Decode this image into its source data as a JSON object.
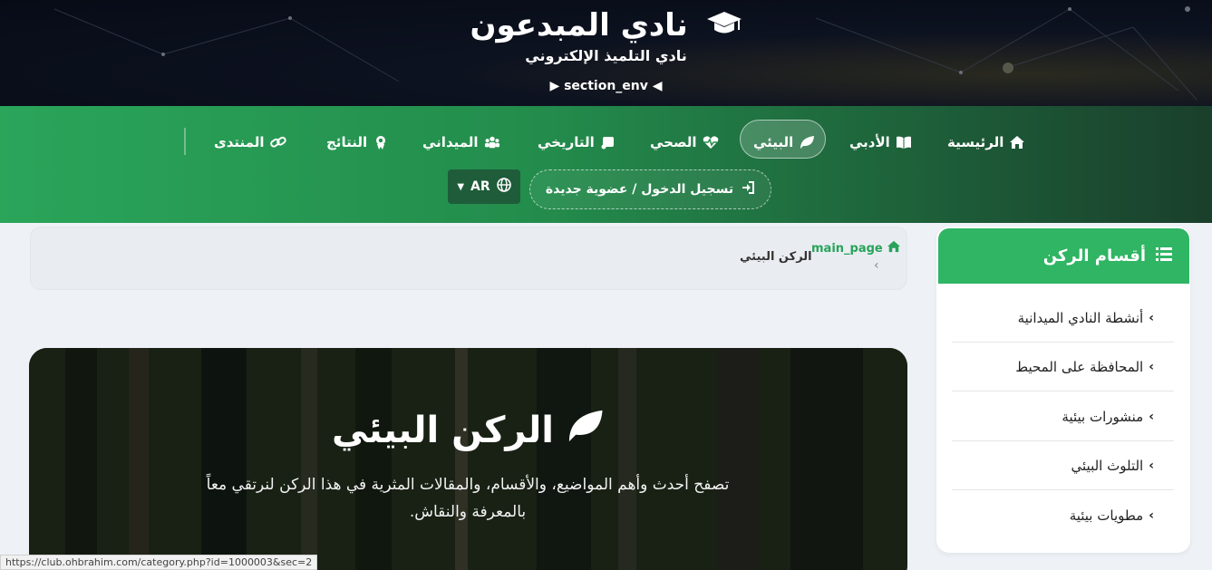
{
  "header": {
    "title": "نادي المبدعون",
    "subtitle": "نادي التلميذ الإلكتروني",
    "section": "▶ section_env ◀"
  },
  "nav": {
    "home": "الرئيسية",
    "literary": "الأدبي",
    "environment": "البيئي",
    "health": "الصحي",
    "history": "التاريخي",
    "field": "الميداني",
    "results": "النتائج",
    "forum": "المنتدى",
    "login": "تسجيل الدخول / عضوية جديدة",
    "lang": "AR"
  },
  "breadcrumb": {
    "home": "main_page",
    "current": "الركن البيئي",
    "sep": "‹"
  },
  "hero": {
    "title": "الركن البيئي",
    "description": "تصفح أحدث وأهم المواضيع، والأقسام، والمقالات المثرية في هذا الركن لنرتقي معاً بالمعرفة والنقاش."
  },
  "sidebar": {
    "title": "أقسام الركن",
    "items": [
      {
        "label": "أنشطة النادي الميدانية"
      },
      {
        "label": "المحافظة على المحيط"
      },
      {
        "label": "منشورات بيئية"
      },
      {
        "label": "التلوث البيئي"
      },
      {
        "label": "مطويات بيئية"
      }
    ]
  },
  "status_url": "https://club.ohbrahim.com/category.php?id=1000003&sec=2",
  "colors": {
    "accent": "#2fb563",
    "nav_start": "#2aa55a",
    "nav_end": "#1a3f2c",
    "header_bg": "#070b16"
  }
}
